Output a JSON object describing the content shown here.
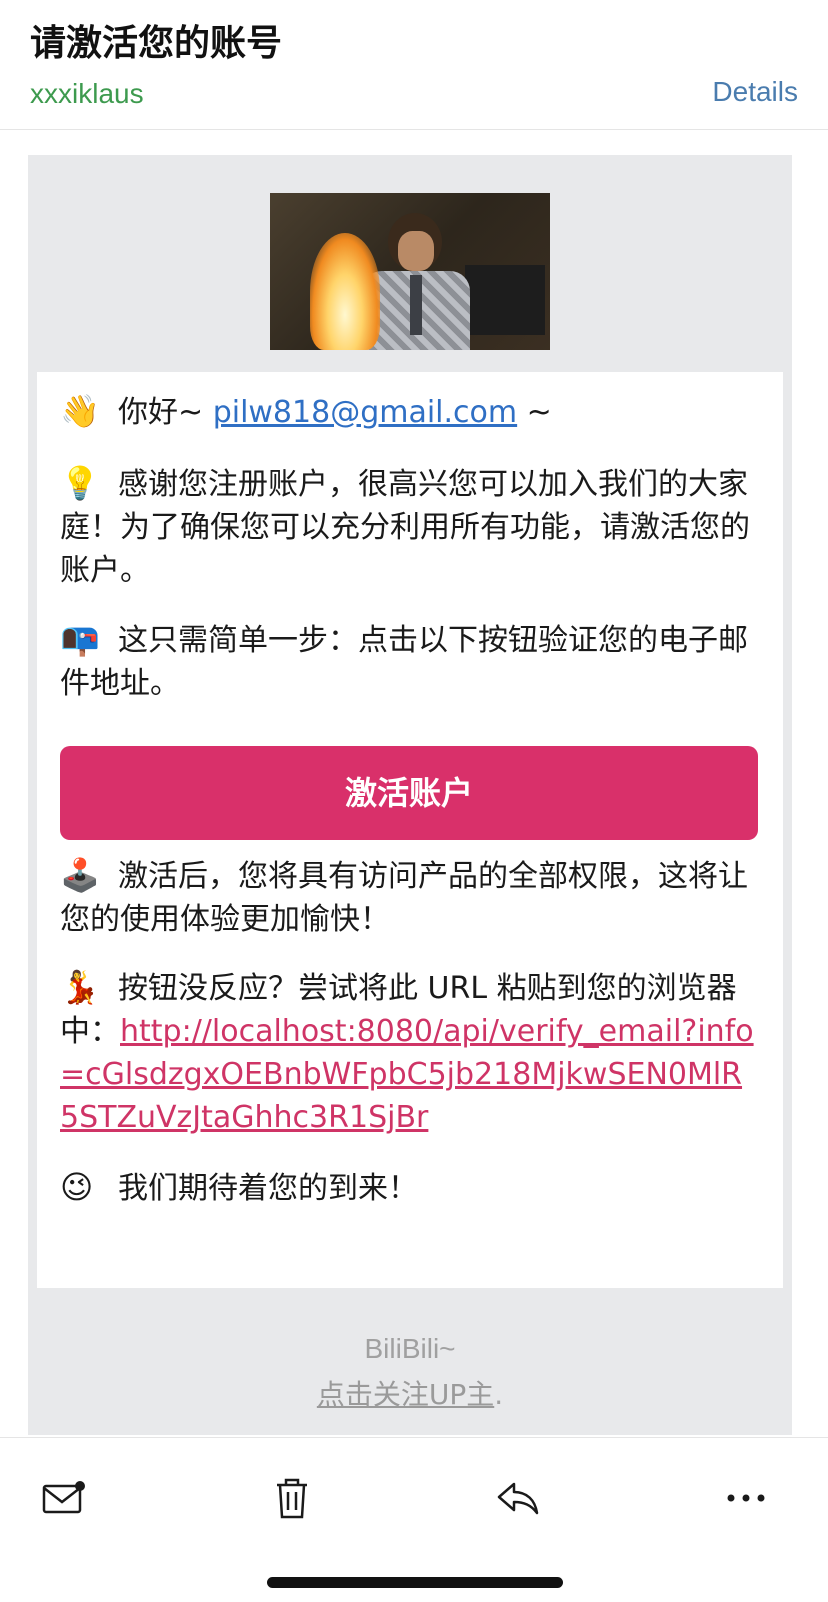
{
  "header": {
    "subject": "请激活您的账号",
    "sender": "xxxiklaus",
    "details_label": "Details"
  },
  "email": {
    "greeting_prefix": "你好~ ",
    "greeting_email": "pilw818@gmail.com",
    "greeting_suffix": " ~",
    "thanks_text": "感谢您注册账户，很高兴您可以加入我们的大家庭！为了确保您可以充分利用所有功能，请激活您的账户。",
    "step_text": "这只需简单一步：点击以下按钮验证您的电子邮件地址。",
    "activate_button": "激活账户",
    "after_text": "激活后，您将具有访问产品的全部权限，这将让您的使用体验更加愉快！",
    "fallback_text": "按钮没反应？尝试将此 URL 粘贴到您的浏览器中：",
    "verify_url": "http://localhost:8080/api/verify_email?info=cGlsdzgxOEBnbWFpbC5jb218MjkwSEN0MlR5STZuVzJtaGhhc3R1SjBr",
    "closing_text": "我们期待着您的到来！",
    "emojis": {
      "wave": "👋",
      "bulb": "💡",
      "mailbox": "📭",
      "joystick": "🕹️",
      "dancer": "💃",
      "wink": "😉"
    }
  },
  "footer": {
    "brand": "BiliBili~",
    "follow_link": "点击关注UP主",
    "follow_suffix": "."
  },
  "toolbar": {
    "icons": [
      "mail-unread-icon",
      "trash-icon",
      "reply-icon",
      "more-icon"
    ]
  }
}
